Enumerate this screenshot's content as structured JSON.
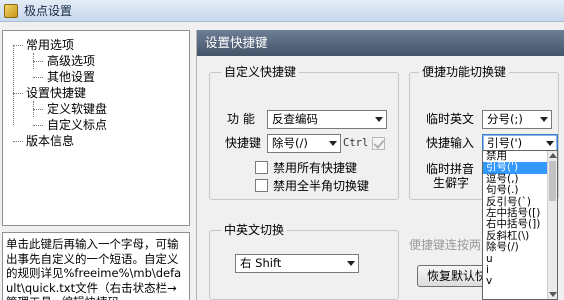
{
  "window": {
    "title": "极点设置"
  },
  "tree": {
    "items": [
      {
        "label": "常用选项"
      },
      {
        "label": "高级选项"
      },
      {
        "label": "其他设置"
      },
      {
        "label": "设置快捷键"
      },
      {
        "label": "定义软键盘"
      },
      {
        "label": "自定义标点"
      },
      {
        "label": "版本信息"
      }
    ]
  },
  "help_text": "单击此键后再输入一个字母，可输出事先自定义的一个短语。自定义的规则详见%freeime%\\mb\\default\\quick.txt文件（右击状态栏→管理工具→编辑快捷码",
  "panel": {
    "title": "设置快捷键",
    "custom_group": {
      "legend": "自定义快捷键",
      "function_label": "功  能",
      "function_value": "反查编码",
      "hotkey_label": "快捷键",
      "hotkey_value": "除号(/)",
      "ctrl_label": "Ctrl",
      "disable_all_label": "禁用所有快捷键",
      "disable_fullhalf_label": "禁用全半角切换键"
    },
    "switch_group": {
      "legend": "便捷功能切换键",
      "temp_english_label": "临时英文",
      "temp_english_value": "分号(;)",
      "quick_input_label": "快捷输入",
      "quick_input_value": "引号(')",
      "temp_pinyin_label": "临时拼音",
      "rare_char_label": "生僻字"
    },
    "cn_en_group": {
      "legend": "中英文切换",
      "value": "右 Shift"
    },
    "hint_text": "便捷键连按两次",
    "restore_button": "恢复默认快"
  },
  "dropdown": {
    "options": [
      {
        "label": "禁用",
        "selected": false
      },
      {
        "label": "引号(')",
        "selected": true
      },
      {
        "label": "逗号(,)",
        "selected": false
      },
      {
        "label": "句号(.)",
        "selected": false
      },
      {
        "label": "反引号(`)",
        "selected": false
      },
      {
        "label": "左中括号([)",
        "selected": false
      },
      {
        "label": "右中括号(])",
        "selected": false
      },
      {
        "label": "反斜杠(\\)",
        "selected": false
      },
      {
        "label": "除号(/)",
        "selected": false
      },
      {
        "label": "u",
        "selected": false
      },
      {
        "label": "i",
        "selected": false
      },
      {
        "label": "v",
        "selected": false
      }
    ]
  }
}
